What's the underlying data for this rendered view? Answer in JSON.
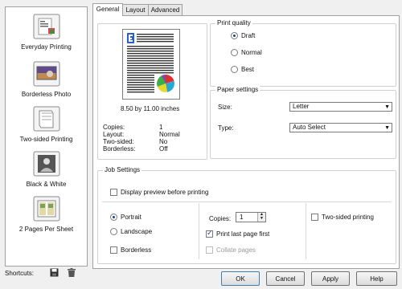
{
  "sidebar": {
    "items": [
      {
        "label": "Everyday Printing",
        "icon": "everyday-printing-icon"
      },
      {
        "label": "Borderless Photo",
        "icon": "borderless-photo-icon"
      },
      {
        "label": "Two-sided Printing",
        "icon": "two-sided-printing-icon"
      },
      {
        "label": "Black & White",
        "icon": "black-white-icon"
      },
      {
        "label": "2 Pages Per Sheet",
        "icon": "two-pages-per-sheet-icon"
      }
    ],
    "shortcuts_label": "Shortcuts:"
  },
  "tabs": [
    {
      "label": "General",
      "active": true
    },
    {
      "label": "Layout",
      "active": false
    },
    {
      "label": "Advanced",
      "active": false
    }
  ],
  "preview": {
    "size_text": "8.50 by 11.00 inches",
    "summary": [
      {
        "key": "Copies:",
        "value": "1"
      },
      {
        "key": "Layout:",
        "value": "Normal"
      },
      {
        "key": "Two-sided:",
        "value": "No"
      },
      {
        "key": "Borderless:",
        "value": "Off"
      }
    ]
  },
  "print_quality": {
    "title": "Print quality",
    "options": [
      "Draft",
      "Normal",
      "Best"
    ],
    "selected": "Draft"
  },
  "paper_settings": {
    "title": "Paper settings",
    "size_label": "Size:",
    "size_value": "Letter",
    "type_label": "Type:",
    "type_value": "Auto Select"
  },
  "job_settings": {
    "title": "Job Settings",
    "display_preview": "Display preview before printing",
    "portrait": "Portrait",
    "landscape": "Landscape",
    "borderless": "Borderless",
    "copies_label": "Copies:",
    "copies_value": "1",
    "print_last_first": "Print last page first",
    "collate": "Collate pages",
    "two_sided": "Two-sided printing"
  },
  "buttons": {
    "ok": "OK",
    "cancel": "Cancel",
    "apply": "Apply",
    "help": "Help"
  },
  "colors": {
    "accent": "#1c3f94",
    "page_blue": "#2b5fd3"
  }
}
